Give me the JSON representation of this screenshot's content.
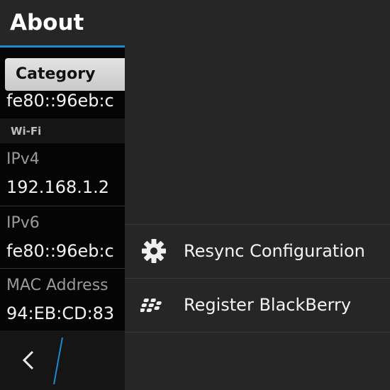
{
  "about_page": {
    "title": "About",
    "category_dropdown": {
      "selected": "Category"
    },
    "partial_top_value": "fe80::96eb:c",
    "section_label": "Wi-Fi",
    "fields": [
      {
        "label": "IPv4",
        "value": "192.168.1.2"
      },
      {
        "label": "IPv6",
        "value": "fe80::96eb:c"
      },
      {
        "label": "MAC Address",
        "value": "94:EB:CD:83"
      }
    ],
    "colors": {
      "accent": "#1a8bd0"
    }
  },
  "action_menu": {
    "items": [
      {
        "label": "Resync Configuration",
        "icon": "gear-icon"
      },
      {
        "label": "Register BlackBerry",
        "icon": "blackberry-logo-icon"
      }
    ]
  },
  "action_bar": {
    "back_icon": "chevron-left-icon"
  }
}
